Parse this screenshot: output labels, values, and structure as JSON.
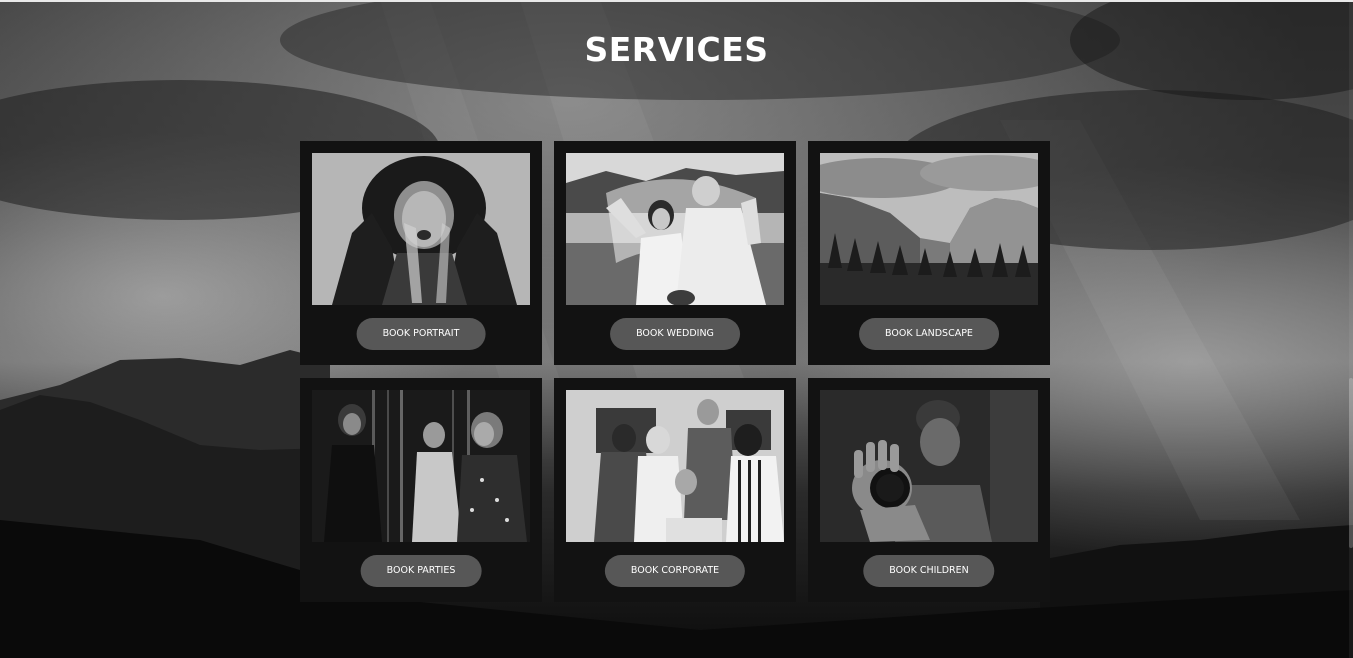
{
  "section": {
    "title": "SERVICES"
  },
  "services": [
    {
      "button_label": "BOOK PORTRAIT",
      "image_subject": "woman-in-fur-hood"
    },
    {
      "button_label": "BOOK WEDDING",
      "image_subject": "wedding-couple-with-veil"
    },
    {
      "button_label": "BOOK LANDSCAPE",
      "image_subject": "mountain-cliffs-and-forest"
    },
    {
      "button_label": "BOOK PARTIES",
      "image_subject": "three-women-at-party"
    },
    {
      "button_label": "BOOK CORPORATE",
      "image_subject": "team-around-laptop"
    },
    {
      "button_label": "BOOK CHILDREN",
      "image_subject": "child-holding-lens-cap"
    }
  ],
  "colors": {
    "card_background": "#121212",
    "button_background": "#575757",
    "button_text": "#ffffff",
    "title_text": "#ffffff"
  }
}
